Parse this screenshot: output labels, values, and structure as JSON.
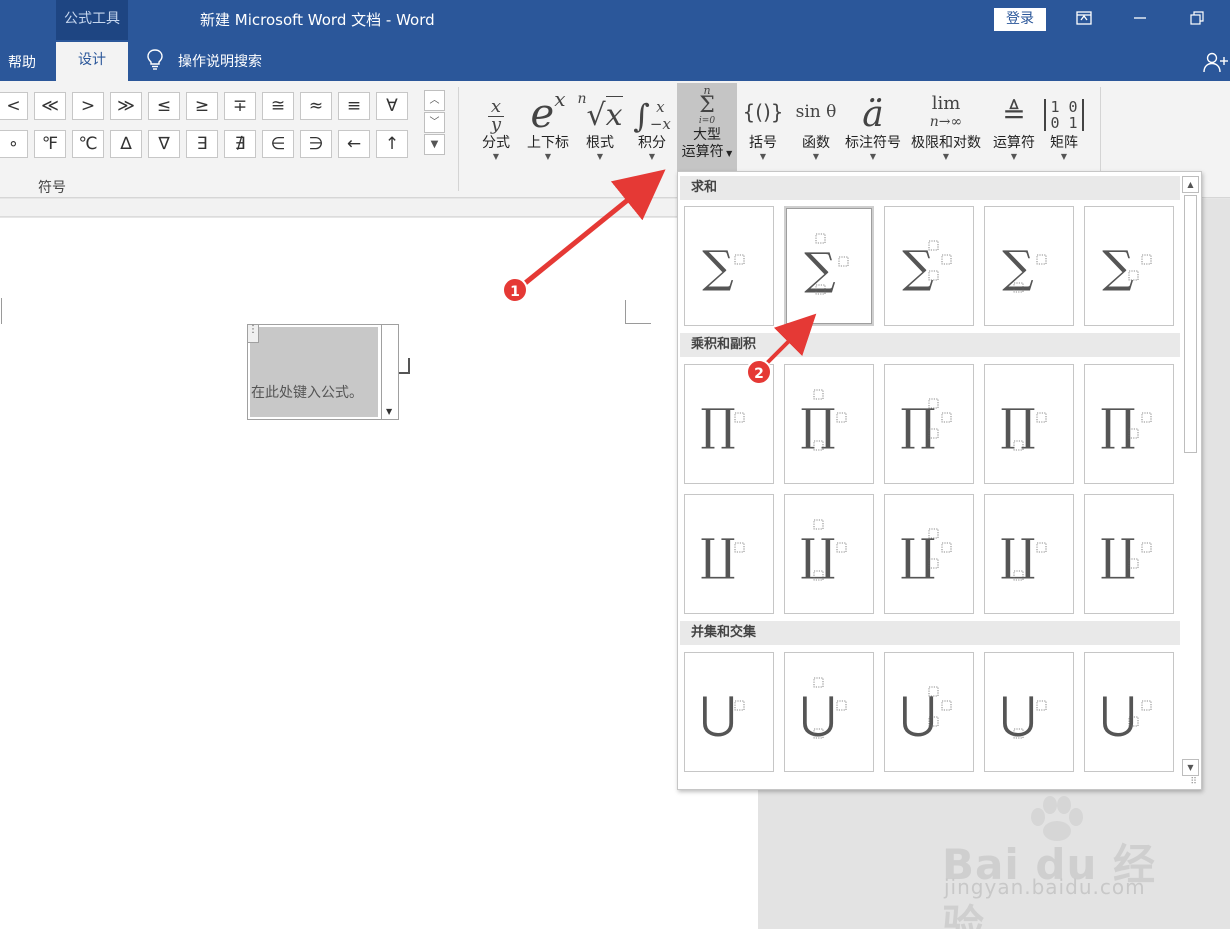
{
  "titlebar": {
    "context_tab": "公式工具",
    "title": "新建 Microsoft Word 文档 - Word",
    "login": "登录"
  },
  "tabs": {
    "help": "帮助",
    "design": "设计",
    "tell_me": "操作说明搜索"
  },
  "symbols": {
    "row1": [
      "<",
      "≪",
      ">",
      "≫",
      "≤",
      "≥",
      "∓",
      "≅",
      "≈",
      "≡",
      "∀"
    ],
    "row2": [
      "∘",
      "℉",
      "℃",
      "∆",
      "∇",
      "∃",
      "∄",
      "∈",
      "∋",
      "←",
      "↑"
    ],
    "group_label": "符号"
  },
  "structures": {
    "fraction": "分式",
    "script": "上下标",
    "radical": "根式",
    "integral": "积分",
    "large_operator_1": "大型",
    "large_operator_2": "运算符",
    "bracket": "括号",
    "function": "函数",
    "accent": "标注符号",
    "limit_log": "极限和对数",
    "operator": "运算符",
    "matrix": "矩阵",
    "icons": {
      "fraction_num": "x",
      "fraction_den": "y",
      "script_base": "e",
      "script_sup": "x",
      "radical_index": "n",
      "radical_base": "x",
      "integral_sign": "∫",
      "integral_sup": "x",
      "integral_sub": "−x",
      "sum_top": "n",
      "sum_sign": "Σ",
      "sum_bottom": "i=0",
      "bracket_glyph": "{()}",
      "function_glyph": "sin θ",
      "accent_glyph": "ä",
      "limit_top": "lim",
      "limit_bottom": "n→∞",
      "operator_glyph": "≜",
      "matrix_row1": "1 0",
      "matrix_row2": "0 1"
    }
  },
  "document": {
    "placeholder": "在此处键入公式。"
  },
  "gallery": {
    "sections": [
      {
        "title": "求和",
        "glyph": "∑",
        "rows": 1
      },
      {
        "title": "乘积和副积",
        "glyph": "∏∐",
        "rows": 2
      },
      {
        "title": "并集和交集",
        "glyph": "⋃",
        "rows": 1
      }
    ]
  },
  "annotations": {
    "badge1": "1",
    "badge2": "2",
    "arrow_color": "#e53935"
  },
  "watermark": {
    "brand": "Bai du 经验",
    "url": "jingyan.baidu.com"
  },
  "colors": {
    "accent": "#2b579a",
    "ribbon": "#f3f3f3",
    "active_button": "#c5c5c5"
  }
}
